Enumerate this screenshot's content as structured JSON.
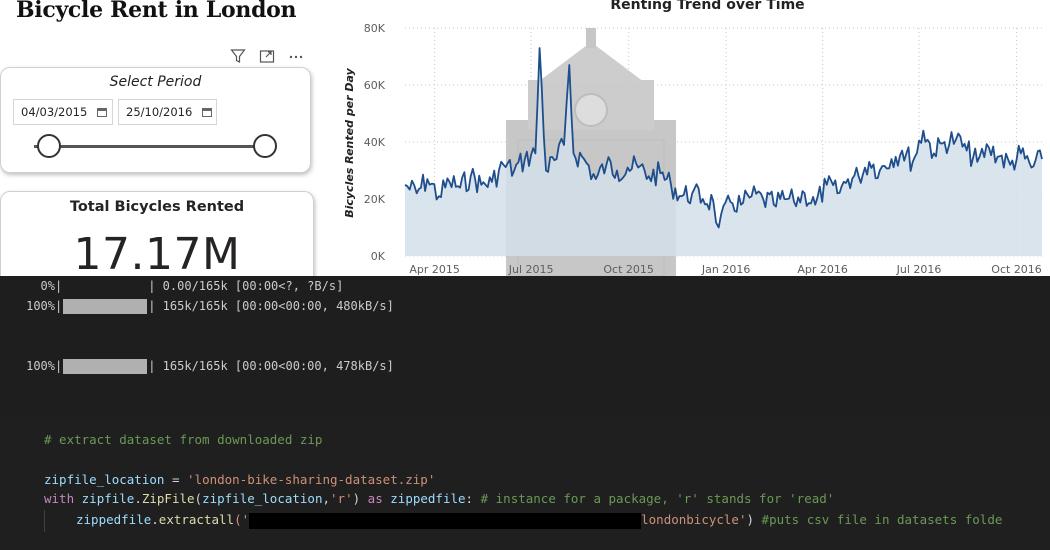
{
  "dashboard": {
    "title": "Bicycle Rent in London",
    "toolbar_icons": [
      "filter-icon",
      "focus-mode-icon",
      "more-options-icon"
    ],
    "period_slicer": {
      "title": "Select Period",
      "start_date": "04/03/2015",
      "end_date": "25/10/2016",
      "range_fraction": [
        0.0,
        1.0
      ]
    },
    "total_card": {
      "label": "Total Bicycles Rented",
      "value": "17.17M"
    },
    "chart_title": "Renting Trend over Time"
  },
  "chart_data": {
    "type": "area",
    "title": "Renting Trend over Time",
    "xlabel": "",
    "ylabel": "Bicycles Rented per Day",
    "x_tick_labels": [
      "Apr 2015",
      "Jul 2015",
      "Oct 2015",
      "Jan 2016",
      "Apr 2016",
      "Jul 2016",
      "Oct 2016"
    ],
    "y_tick_labels": [
      "0K",
      "20K",
      "40K",
      "60K",
      "80K"
    ],
    "ylim": [
      0,
      80000
    ],
    "xlim": [
      "2015-03-04",
      "2016-10-25"
    ],
    "grid": "dotted, both axes",
    "line_color": "#1f4e8c",
    "fill_color": "#d4dfea",
    "series": [
      {
        "x": [
          "2015-03-04",
          "2015-03-15",
          "2015-03-25",
          "2015-04-05",
          "2015-04-15",
          "2015-04-25",
          "2015-05-05",
          "2015-05-15",
          "2015-05-25",
          "2015-06-05",
          "2015-06-15",
          "2015-06-25",
          "2015-07-05",
          "2015-07-09",
          "2015-07-15",
          "2015-07-25",
          "2015-08-01",
          "2015-08-06",
          "2015-08-10",
          "2015-08-20",
          "2015-08-31",
          "2015-09-10",
          "2015-09-20",
          "2015-09-30",
          "2015-10-10",
          "2015-10-20",
          "2015-10-31",
          "2015-11-10",
          "2015-11-20",
          "2015-11-30",
          "2015-12-10",
          "2015-12-20",
          "2015-12-25",
          "2016-01-05",
          "2016-01-15",
          "2016-01-25",
          "2016-02-05",
          "2016-02-15",
          "2016-02-25",
          "2016-03-05",
          "2016-03-15",
          "2016-03-25",
          "2016-04-05",
          "2016-04-15",
          "2016-04-25",
          "2016-05-05",
          "2016-05-15",
          "2016-05-25",
          "2016-06-05",
          "2016-06-15",
          "2016-06-25",
          "2016-07-05",
          "2016-07-15",
          "2016-07-25",
          "2016-08-05",
          "2016-08-15",
          "2016-08-25",
          "2016-09-05",
          "2016-09-15",
          "2016-09-25",
          "2016-10-05",
          "2016-10-15",
          "2016-10-25"
        ],
        "y": [
          25000,
          22000,
          27000,
          21000,
          26000,
          24000,
          28000,
          25000,
          26000,
          32000,
          30000,
          34000,
          36000,
          73000,
          30000,
          34000,
          39000,
          67000,
          36000,
          34000,
          27000,
          32000,
          30000,
          31000,
          31000,
          28000,
          29000,
          25000,
          21000,
          22000,
          20000,
          19000,
          10000,
          19000,
          18000,
          21000,
          20000,
          18000,
          20000,
          19000,
          22000,
          18000,
          25000,
          22000,
          27000,
          28000,
          33000,
          30000,
          34000,
          37000,
          33000,
          44000,
          36000,
          40000,
          41000,
          37000,
          33000,
          38000,
          35000,
          32000,
          36000,
          31000,
          34000
        ]
      }
    ]
  },
  "output": {
    "lines": [
      {
        "pct": "0%",
        "full": false,
        "rest": "| 0.00/165k [00:00<?, ?B/s]"
      },
      {
        "pct": "100%",
        "full": true,
        "rest": "| 165k/165k [00:00<00:00, 480kB/s]"
      },
      {
        "pct": "100%",
        "full": true,
        "rest": "| 165k/165k [00:00<00:00, 478kB/s]"
      }
    ]
  },
  "code": {
    "comment": "# extract dataset from downloaded zip",
    "l2_var": "zipfile_location",
    "l2_eq": "= ",
    "l2_str": "'london-bike-sharing-dataset.zip'",
    "l3_with": "with",
    "l3_mod": "zipfile",
    "l3_dot": ".",
    "l3_cls": "ZipFile",
    "l3_args_open": "(",
    "l3_arg1": "zipfile_location",
    "l3_comma": ",",
    "l3_arg2": "'r'",
    "l3_close": ")",
    "l3_as": "as",
    "l3_alias": "zippedfile",
    "l3_colon": ":",
    "l3_comment": "# instance for a package, 'r' stands for 'read'",
    "l4_obj": "zippedfile",
    "l4_dot": ".",
    "l4_fn": "extractall",
    "l4_open": "('",
    "l4_str_tail": "londonbicycle'",
    "l4_close": ")",
    "l4_comment": "#puts csv file in datasets folde"
  }
}
